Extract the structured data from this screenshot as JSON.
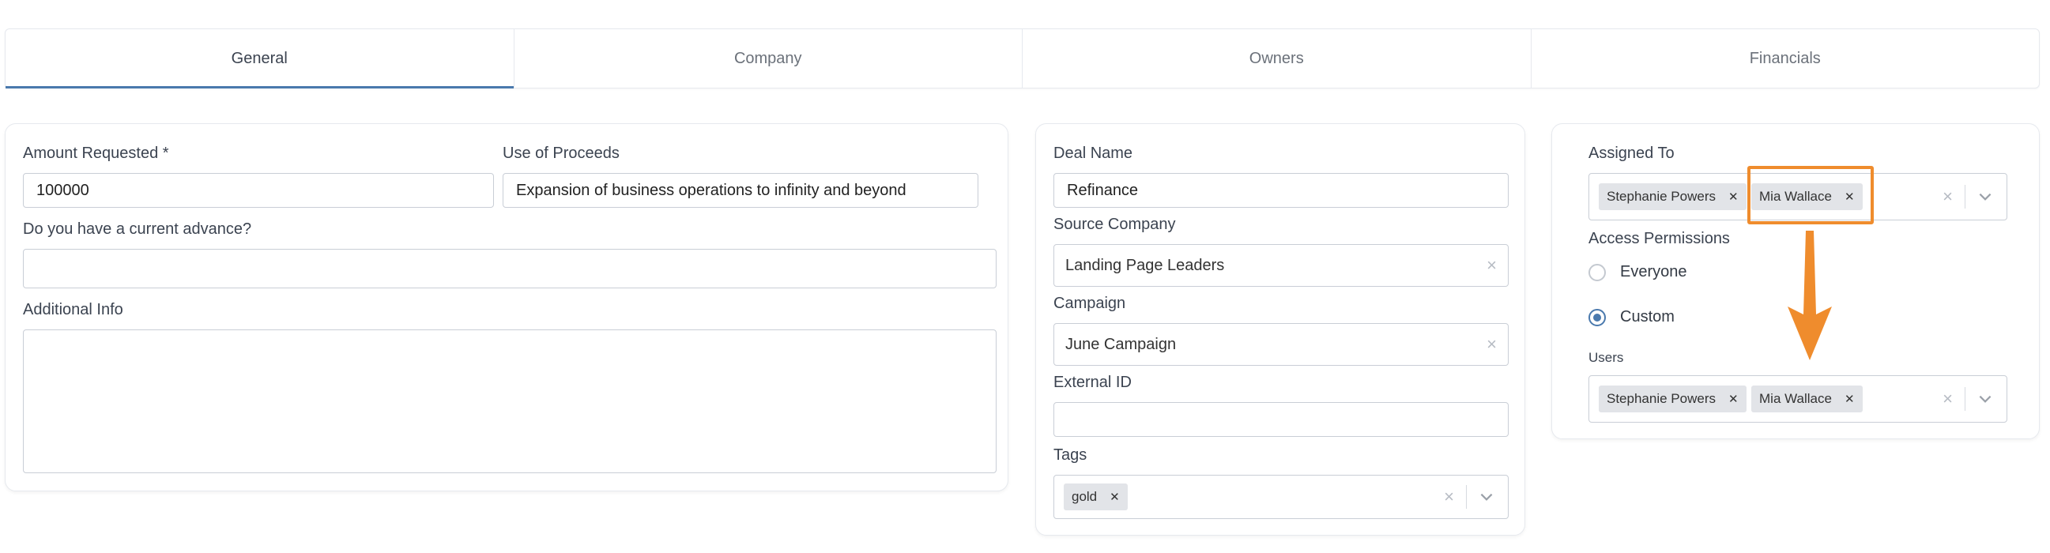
{
  "tabs": [
    {
      "label": "General",
      "active": true
    },
    {
      "label": "Company",
      "active": false
    },
    {
      "label": "Owners",
      "active": false
    },
    {
      "label": "Financials",
      "active": false
    }
  ],
  "general": {
    "amount_label": "Amount Requested *",
    "amount_value": "100000",
    "proceeds_label": "Use of Proceeds",
    "proceeds_value": "Expansion of business operations to infinity and beyond",
    "advance_label": "Do you have a current advance?",
    "advance_value": "",
    "info_label": "Additional Info",
    "info_value": ""
  },
  "deal": {
    "name_label": "Deal Name",
    "name_value": "Refinance",
    "source_label": "Source Company",
    "source_value": "Landing Page Leaders",
    "campaign_label": "Campaign",
    "campaign_value": "June Campaign",
    "external_label": "External ID",
    "external_value": "",
    "tags_label": "Tags",
    "tags": [
      "gold"
    ]
  },
  "assignment": {
    "assigned_label": "Assigned To",
    "assigned": [
      "Stephanie Powers",
      "Mia Wallace"
    ],
    "access_label": "Access Permissions",
    "options": [
      {
        "label": "Everyone",
        "checked": false
      },
      {
        "label": "Custom",
        "checked": true
      }
    ],
    "users_label": "Users",
    "users": [
      "Stephanie Powers",
      "Mia Wallace"
    ]
  },
  "colors": {
    "accent": "#4a79ad",
    "highlight": "#ef8c2d",
    "chip": "#e2e4e8",
    "border": "#c9ced6"
  },
  "icons": {
    "clear": "close-icon",
    "dropdown": "chevron-down-icon",
    "remove_chip": "close-icon",
    "annotation": "arrow-down-icon"
  }
}
